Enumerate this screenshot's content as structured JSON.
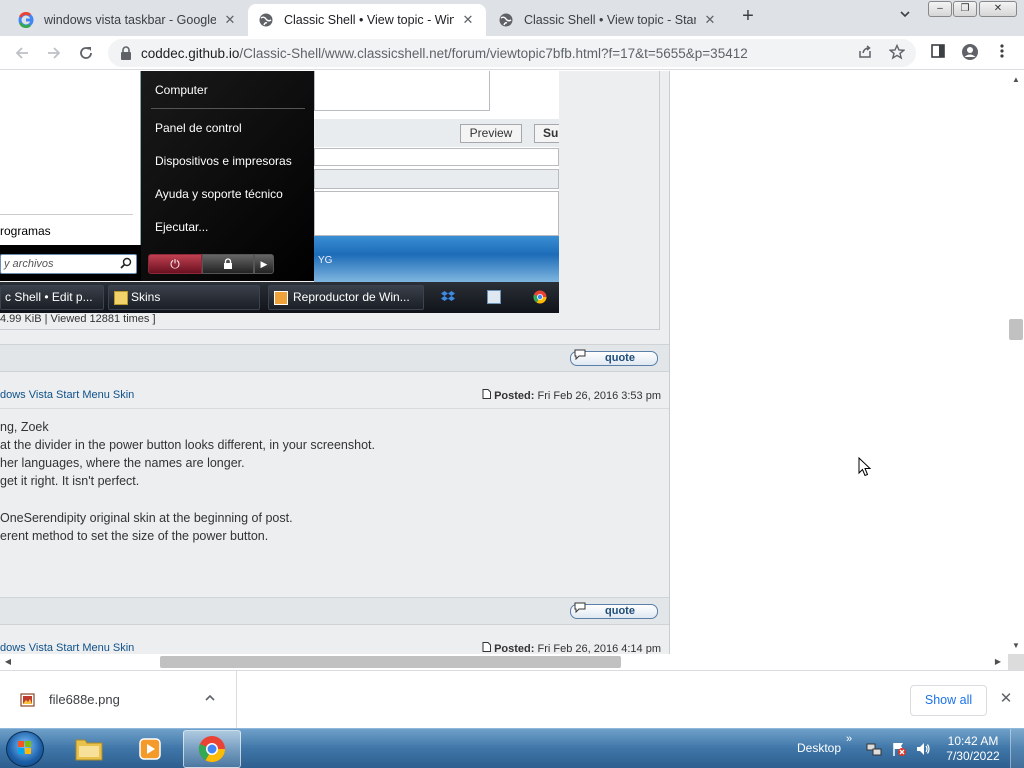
{
  "browser": {
    "tabs": [
      {
        "title": "windows vista taskbar - Google Search",
        "active": false
      },
      {
        "title": "Classic Shell • View topic - Windows Vista Start Menu Skin",
        "active": true
      },
      {
        "title": "Classic Shell • View topic - Start Button",
        "active": false
      }
    ],
    "new_tab": "+",
    "url_host": "coddec.github.io",
    "url_path": "/Classic-Shell/www.classicshell.net/forum/viewtopic7bfb.html?f=17&t=5655&p=35412"
  },
  "screenshot": {
    "start_menu": {
      "right_items": [
        "Computer",
        "Panel de control",
        "Dispositivos e impresoras",
        "Ayuda y soporte técnico",
        "Ejecutar..."
      ],
      "programs_label": "rogramas",
      "search_placeholder": "y archivos"
    },
    "preview_label": "Preview",
    "submit_label": "Su",
    "blue_text": "YG",
    "taskbar_items": [
      {
        "label": "c Shell • Edit p..."
      },
      {
        "label": "Skins"
      },
      {
        "label": "Reproductor de Win..."
      }
    ]
  },
  "forum": {
    "attachment_meta": "4.99 KiB | Viewed 12881 times ]",
    "quote_label": "quote",
    "posts": [
      {
        "subject": "dows Vista Start Menu Skin",
        "posted_label": "Posted:",
        "date": "Fri Feb 26, 2016 3:53 pm",
        "lines": [
          "ng, Zoek",
          "at the divider in the power button looks different, in your screenshot.",
          "her languages, where the names are longer.",
          " get it right. It isn't perfect.",
          "",
          "OneSerendipity original skin at the beginning of post.",
          "erent method to set the size of the power button."
        ]
      },
      {
        "subject": "dows Vista Start Menu Skin",
        "posted_label": "Posted:",
        "date": "Fri Feb 26, 2016 4:14 pm",
        "lines": []
      }
    ]
  },
  "downloads": {
    "file_name": "file688e.png",
    "show_all": "Show all"
  },
  "taskbar": {
    "desktop_label": "Desktop",
    "time": "10:42 AM",
    "date": "7/30/2022"
  },
  "colors": {
    "link": "#105289",
    "chrome_blue": "#1a73e8",
    "forum_bg": "#eceef0"
  }
}
